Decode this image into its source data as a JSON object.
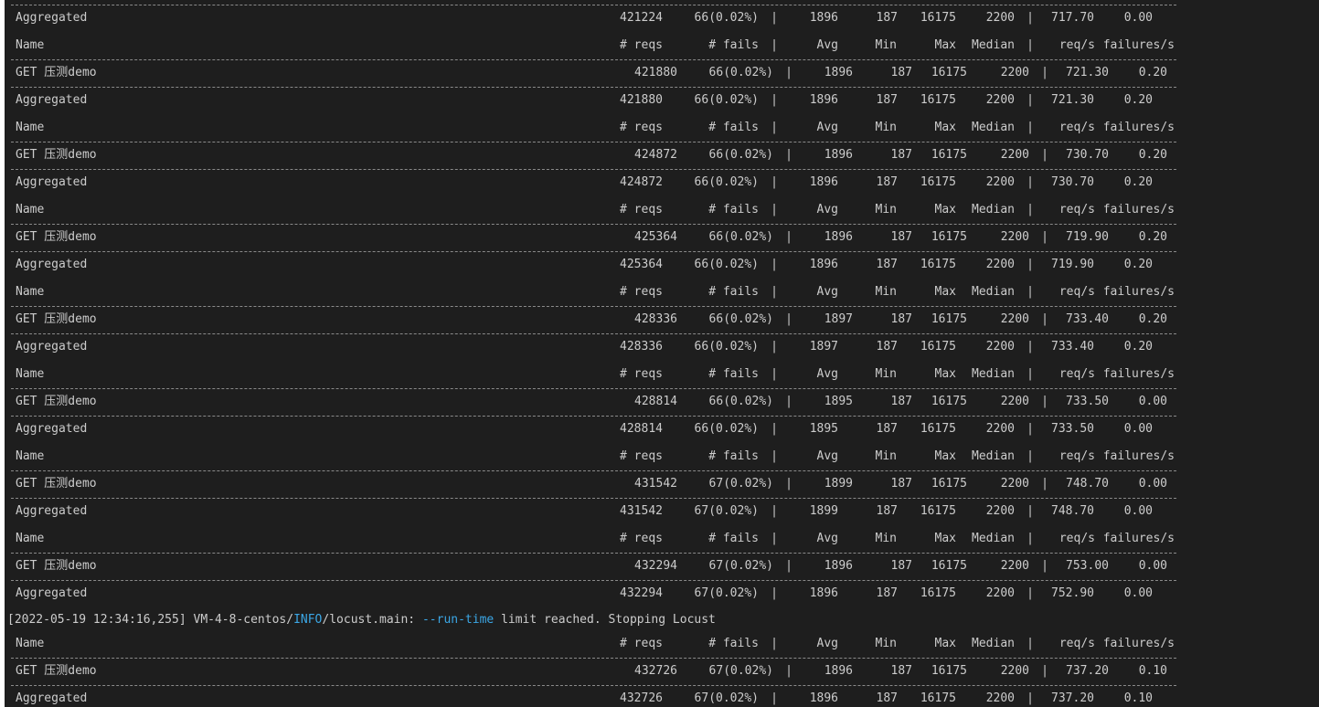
{
  "header": {
    "name": "Name",
    "reqs": "# reqs",
    "fails": "# fails",
    "avg": "Avg",
    "min": "Min",
    "max": "Max",
    "median": "Median",
    "reqps": "req/s",
    "failps": "failures/s"
  },
  "divider": "|",
  "rows": [
    {
      "type": "agg",
      "name": "Aggregated",
      "reqs": "421224",
      "fails": "66(0.02%)",
      "avg": "1896",
      "min": "187",
      "max": "16175",
      "median": "2200",
      "reqps": "717.70",
      "failps": "0.00"
    },
    {
      "type": "header"
    },
    {
      "type": "get",
      "name": "GET 压测demo",
      "reqs": "421880",
      "fails": "66(0.02%)",
      "avg": "1896",
      "min": "187",
      "max": "16175",
      "median": "2200",
      "reqps": "721.30",
      "failps": "0.20"
    },
    {
      "type": "agg",
      "name": "Aggregated",
      "reqs": "421880",
      "fails": "66(0.02%)",
      "avg": "1896",
      "min": "187",
      "max": "16175",
      "median": "2200",
      "reqps": "721.30",
      "failps": "0.20"
    },
    {
      "type": "header"
    },
    {
      "type": "get",
      "name": "GET 压测demo",
      "reqs": "424872",
      "fails": "66(0.02%)",
      "avg": "1896",
      "min": "187",
      "max": "16175",
      "median": "2200",
      "reqps": "730.70",
      "failps": "0.20"
    },
    {
      "type": "agg",
      "name": "Aggregated",
      "reqs": "424872",
      "fails": "66(0.02%)",
      "avg": "1896",
      "min": "187",
      "max": "16175",
      "median": "2200",
      "reqps": "730.70",
      "failps": "0.20"
    },
    {
      "type": "header"
    },
    {
      "type": "get",
      "name": "GET 压测demo",
      "reqs": "425364",
      "fails": "66(0.02%)",
      "avg": "1896",
      "min": "187",
      "max": "16175",
      "median": "2200",
      "reqps": "719.90",
      "failps": "0.20"
    },
    {
      "type": "agg",
      "name": "Aggregated",
      "reqs": "425364",
      "fails": "66(0.02%)",
      "avg": "1896",
      "min": "187",
      "max": "16175",
      "median": "2200",
      "reqps": "719.90",
      "failps": "0.20"
    },
    {
      "type": "header"
    },
    {
      "type": "get",
      "name": "GET 压测demo",
      "reqs": "428336",
      "fails": "66(0.02%)",
      "avg": "1897",
      "min": "187",
      "max": "16175",
      "median": "2200",
      "reqps": "733.40",
      "failps": "0.20"
    },
    {
      "type": "agg",
      "name": "Aggregated",
      "reqs": "428336",
      "fails": "66(0.02%)",
      "avg": "1897",
      "min": "187",
      "max": "16175",
      "median": "2200",
      "reqps": "733.40",
      "failps": "0.20"
    },
    {
      "type": "header"
    },
    {
      "type": "get",
      "name": "GET 压测demo",
      "reqs": "428814",
      "fails": "66(0.02%)",
      "avg": "1895",
      "min": "187",
      "max": "16175",
      "median": "2200",
      "reqps": "733.50",
      "failps": "0.00"
    },
    {
      "type": "agg",
      "name": "Aggregated",
      "reqs": "428814",
      "fails": "66(0.02%)",
      "avg": "1895",
      "min": "187",
      "max": "16175",
      "median": "2200",
      "reqps": "733.50",
      "failps": "0.00"
    },
    {
      "type": "header"
    },
    {
      "type": "get",
      "name": "GET 压测demo",
      "reqs": "431542",
      "fails": "67(0.02%)",
      "avg": "1899",
      "min": "187",
      "max": "16175",
      "median": "2200",
      "reqps": "748.70",
      "failps": "0.00"
    },
    {
      "type": "agg",
      "name": "Aggregated",
      "reqs": "431542",
      "fails": "67(0.02%)",
      "avg": "1899",
      "min": "187",
      "max": "16175",
      "median": "2200",
      "reqps": "748.70",
      "failps": "0.00"
    },
    {
      "type": "header"
    },
    {
      "type": "get",
      "name": "GET 压测demo",
      "reqs": "432294",
      "fails": "67(0.02%)",
      "avg": "1896",
      "min": "187",
      "max": "16175",
      "median": "2200",
      "reqps": "753.00",
      "failps": "0.00"
    },
    {
      "type": "agg",
      "name": "Aggregated",
      "reqs": "432294",
      "fails": "67(0.02%)",
      "avg": "1896",
      "min": "187",
      "max": "16175",
      "median": "2200",
      "reqps": "752.90",
      "failps": "0.00"
    }
  ],
  "log": {
    "prefix": "[2022-05-19 12:34:16,255] VM-4-8-centos/",
    "level": "INFO",
    "module": "/locust.main: ",
    "flag": "--run-time",
    "message": " limit reached. Stopping Locust"
  },
  "final_rows": [
    {
      "type": "header"
    },
    {
      "type": "get",
      "name": "GET 压测demo",
      "reqs": "432726",
      "fails": "67(0.02%)",
      "avg": "1896",
      "min": "187",
      "max": "16175",
      "median": "2200",
      "reqps": "737.20",
      "failps": "0.10"
    },
    {
      "type": "agg",
      "name": "Aggregated",
      "reqs": "432726",
      "fails": "67(0.02%)",
      "avg": "1896",
      "min": "187",
      "max": "16175",
      "median": "2200",
      "reqps": "737.20",
      "failps": "0.10"
    }
  ],
  "colors": {
    "background": "#1e1e1e",
    "text": "#cccccc",
    "highlight": "#3ba7e6"
  }
}
